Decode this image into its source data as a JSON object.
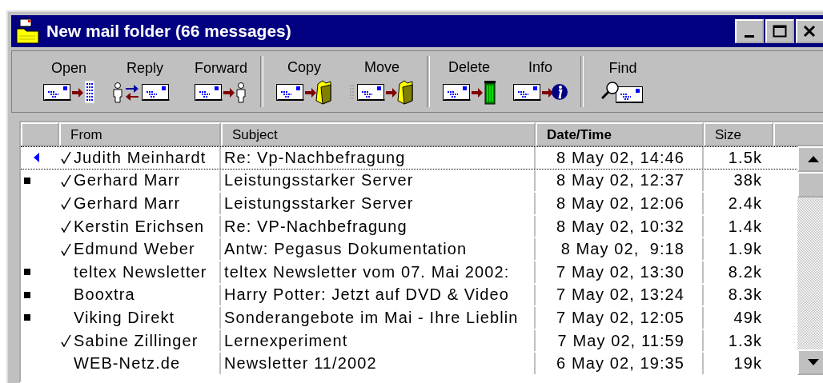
{
  "window": {
    "title": "New mail folder (66 messages)"
  },
  "toolbar": [
    {
      "buttons": [
        {
          "label": "Open",
          "kind": "open"
        },
        {
          "label": "Reply",
          "kind": "reply"
        },
        {
          "label": "Forward",
          "kind": "forward"
        }
      ]
    },
    {
      "buttons": [
        {
          "label": "Copy",
          "kind": "copy"
        },
        {
          "label": "Move",
          "kind": "move"
        }
      ]
    },
    {
      "buttons": [
        {
          "label": "Delete",
          "kind": "delete"
        },
        {
          "label": "Info",
          "kind": "info"
        }
      ]
    },
    {
      "buttons": [
        {
          "label": "Find",
          "kind": "find"
        }
      ]
    }
  ],
  "table": {
    "columns": [
      {
        "label": "From",
        "sorted": false
      },
      {
        "label": "Subject",
        "sorted": false
      },
      {
        "label": "Date/Time",
        "sorted": true
      },
      {
        "label": "Size",
        "sorted": false
      }
    ],
    "rows": [
      {
        "current": true,
        "unread": false,
        "replied": true,
        "from": "Judith Meinhardt",
        "subject": "Re: Vp-Nachbefragung",
        "date": "8 May 02, 14:46",
        "size": "1.5k",
        "selected": true
      },
      {
        "current": false,
        "unread": true,
        "replied": true,
        "from": "Gerhard Marr",
        "subject": "Leistungsstarker Server",
        "date": "8 May 02, 12:37",
        "size": "38k",
        "selected": false
      },
      {
        "current": false,
        "unread": false,
        "replied": true,
        "from": "Gerhard Marr",
        "subject": "Leistungsstarker Server",
        "date": "8 May 02, 12:06",
        "size": "2.4k",
        "selected": false
      },
      {
        "current": false,
        "unread": false,
        "replied": true,
        "from": "Kerstin Erichsen",
        "subject": "Re: VP-Nachbefragung",
        "date": "8 May 02, 10:32",
        "size": "1.4k",
        "selected": false
      },
      {
        "current": false,
        "unread": false,
        "replied": true,
        "from": "Edmund Weber",
        "subject": "Antw: Pegasus Dokumentation",
        "date": "8 May 02,  9:18",
        "size": "1.9k",
        "selected": false
      },
      {
        "current": false,
        "unread": true,
        "replied": false,
        "from": "teltex Newsletter",
        "subject": "teltex Newsletter vom 07. Mai 2002:",
        "date": "7 May 02, 13:30",
        "size": "8.2k",
        "selected": false
      },
      {
        "current": false,
        "unread": true,
        "replied": false,
        "from": "Booxtra",
        "subject": "Harry Potter: Jetzt auf DVD & Video",
        "date": "7 May 02, 13:24",
        "size": "8.3k",
        "selected": false
      },
      {
        "current": false,
        "unread": true,
        "replied": false,
        "from": "Viking Direkt",
        "subject": "Sonderangebote im Mai - Ihre Lieblin",
        "date": "7 May 02, 12:05",
        "size": "49k",
        "selected": false
      },
      {
        "current": false,
        "unread": false,
        "replied": true,
        "from": "Sabine Zillinger",
        "subject": "Lernexperiment",
        "date": "7 May 02, 11:59",
        "size": "1.3k",
        "selected": false
      },
      {
        "current": false,
        "unread": false,
        "replied": false,
        "from": "WEB-Netz.de",
        "subject": "Newsletter 11/2002",
        "date": "6 May 02, 19:35",
        "size": "19k",
        "selected": false
      }
    ]
  }
}
